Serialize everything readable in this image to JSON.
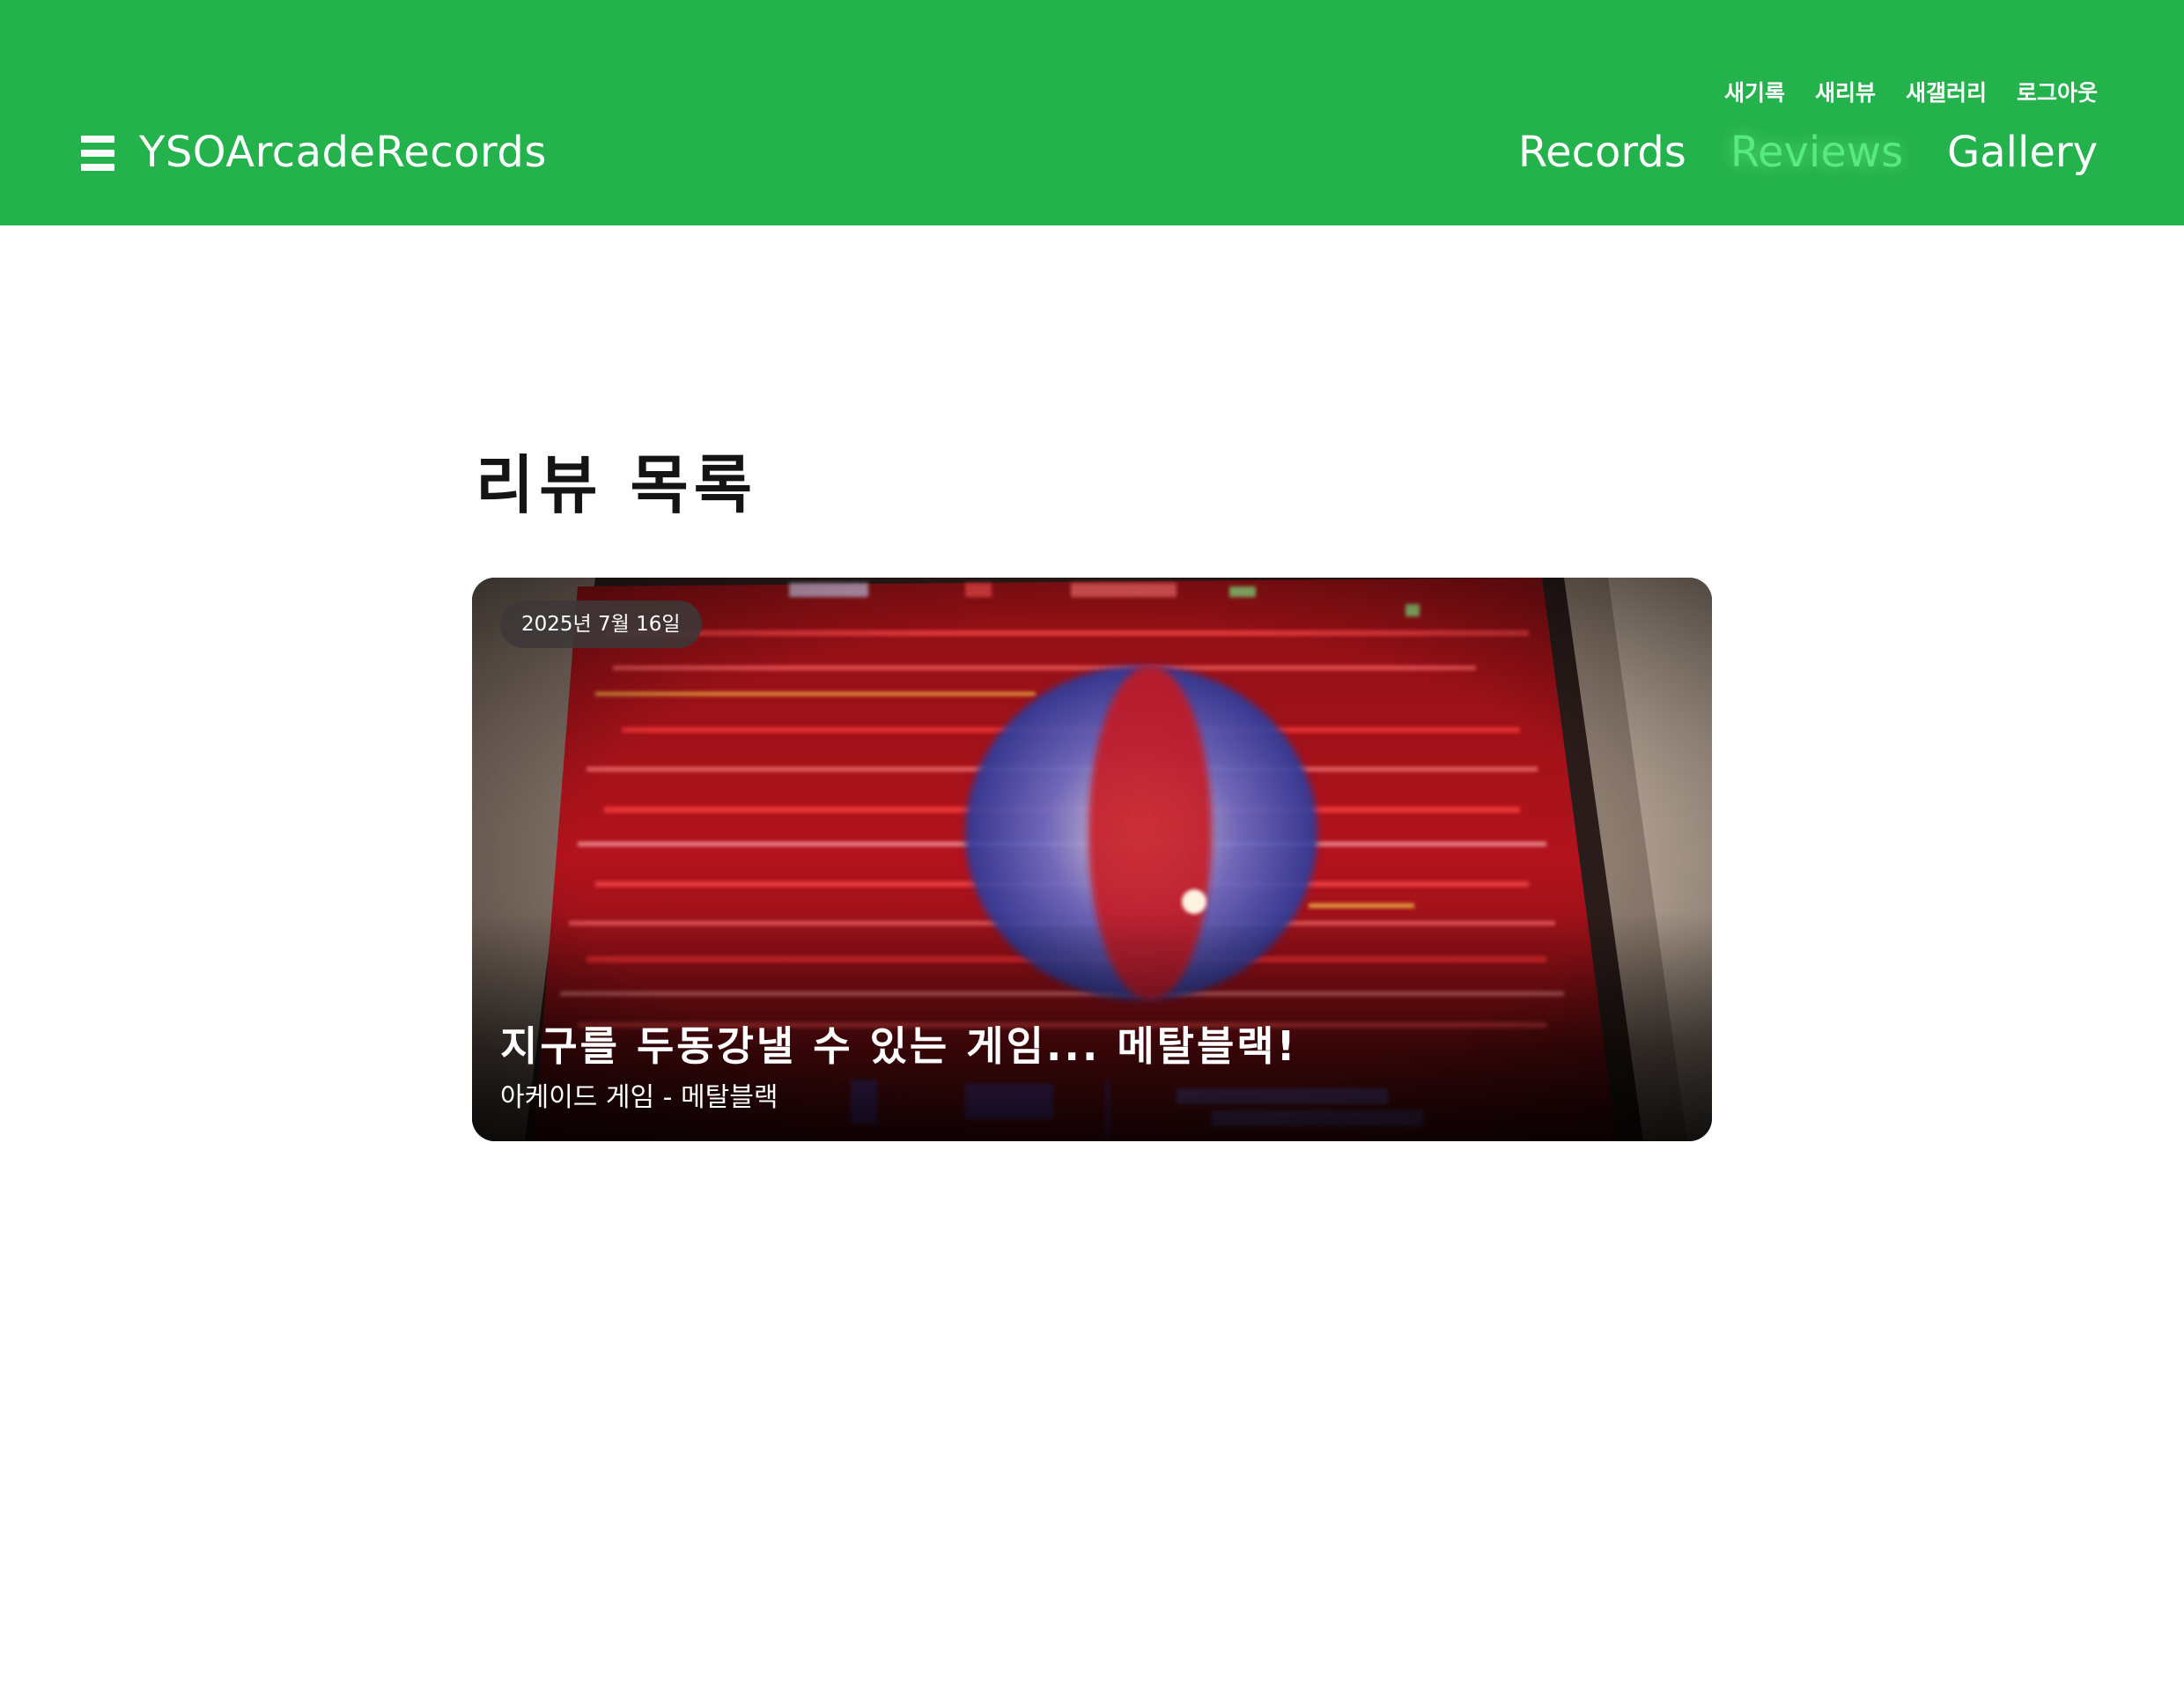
{
  "header": {
    "brand": "YSOArcadeRecords",
    "background_color": "#24b24c",
    "menu_icon": "hamburger-menu-icon",
    "util_links": [
      "새기록",
      "새리뷰",
      "새갤러리",
      "로그아웃"
    ],
    "nav": {
      "items": [
        "Records",
        "Reviews",
        "Gallery"
      ],
      "active": "Reviews",
      "active_color": "#57ea7e"
    }
  },
  "main": {
    "title": "리뷰 목록",
    "reviews": [
      {
        "date": "2025년 7월 16일",
        "title": "지구를 두동강낼 수 있는 게임... 메탈블랙!",
        "subtitle": "아케이드 게임 - 메탈블랙"
      }
    ]
  }
}
